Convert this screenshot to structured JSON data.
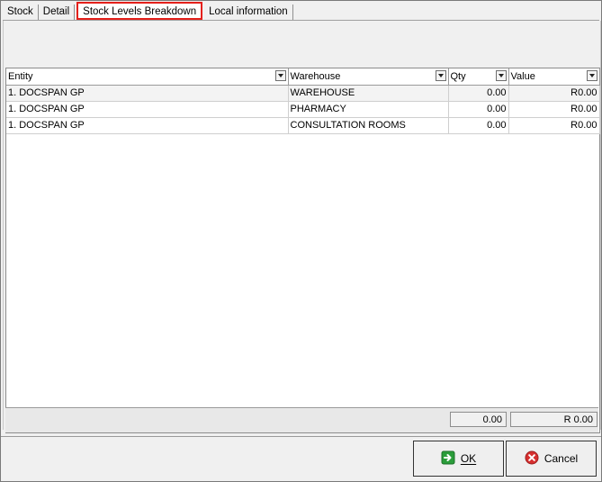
{
  "tabs": [
    {
      "label": "Stock"
    },
    {
      "label": "Detail"
    },
    {
      "label": "Stock Levels Breakdown",
      "active": true
    },
    {
      "label": "Local information"
    }
  ],
  "grid": {
    "columns": [
      "Entity",
      "Warehouse",
      "Qty",
      "Value"
    ],
    "rows": [
      {
        "entity": "1. DOCSPAN GP",
        "warehouse": "WAREHOUSE",
        "qty": "0.00",
        "value": "R0.00"
      },
      {
        "entity": "1. DOCSPAN GP",
        "warehouse": "PHARMACY",
        "qty": "0.00",
        "value": "R0.00"
      },
      {
        "entity": "1. DOCSPAN GP",
        "warehouse": "CONSULTATION ROOMS",
        "qty": "0.00",
        "value": "R0.00"
      }
    ],
    "totals": {
      "qty": "0.00",
      "value": "R 0.00"
    }
  },
  "buttons": {
    "ok_label": "OK",
    "cancel_label": "Cancel"
  },
  "colors": {
    "active_tab_highlight": "#e4201b",
    "ok_icon": "#2a9d3a",
    "cancel_icon": "#d62f2f"
  },
  "icons": {
    "ok": "arrow-right-into-box-icon",
    "cancel": "x-circle-icon",
    "dropdown": "chevron-down-icon"
  }
}
